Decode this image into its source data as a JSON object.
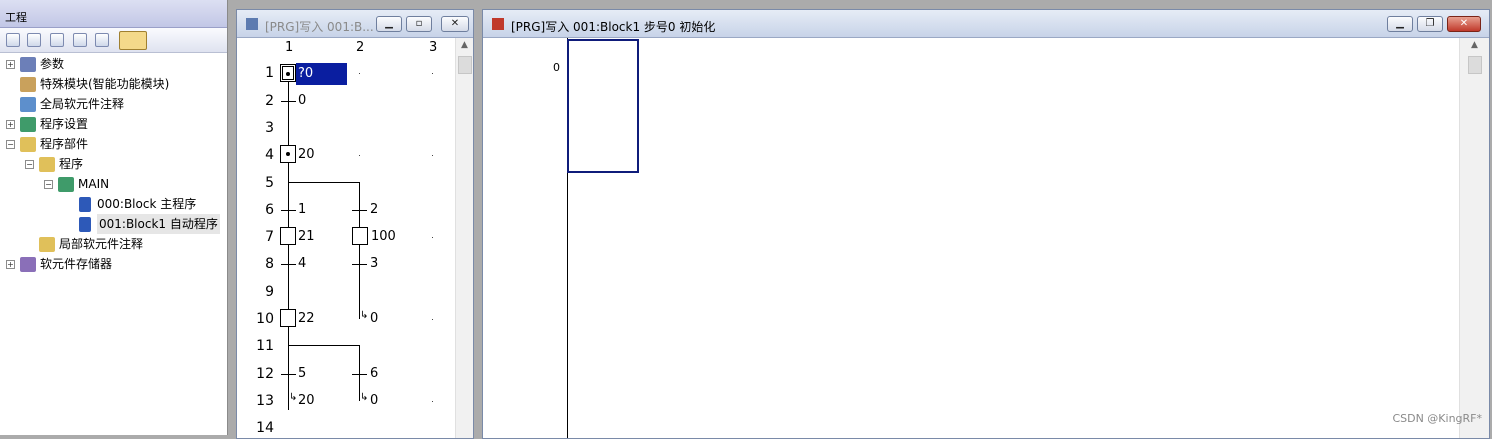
{
  "project": {
    "title": "工程",
    "tree": [
      "参数",
      "特殊模块(智能功能模块)",
      "全局软元件注释",
      "程序设置",
      "程序部件",
      "程序",
      "MAIN",
      "000:Block 主程序",
      "001:Block1 自动程序",
      "局部软元件注释",
      "软元件存储器"
    ]
  },
  "sfc_window": {
    "title": "[PRG]写入 001:B...",
    "columns": [
      "1",
      "2",
      "3"
    ],
    "rows": [
      "1",
      "2",
      "3",
      "4",
      "5",
      "6",
      "7",
      "8",
      "9",
      "10",
      "11",
      "12",
      "13",
      "14"
    ],
    "labels": {
      "r1c1": "?0",
      "r2c1": "0",
      "r4c1": "20",
      "r6c1": "1",
      "r6c2": "2",
      "r7c1": "21",
      "r7c2": "100",
      "r8c1": "4",
      "r8c2": "3",
      "r10c1": "22",
      "r10c2": "0",
      "r12c1": "5",
      "r12c2": "6",
      "r13c1": "20",
      "r13c2": "0"
    }
  },
  "ladder_window": {
    "title": "[PRG]写入 001:Block1 步号0 初始化",
    "step_number": "0"
  },
  "watermark": "CSDN @KingRF*",
  "colors": {
    "selection": "#0a1ea0",
    "cursor_border": "#0f1c7a"
  }
}
